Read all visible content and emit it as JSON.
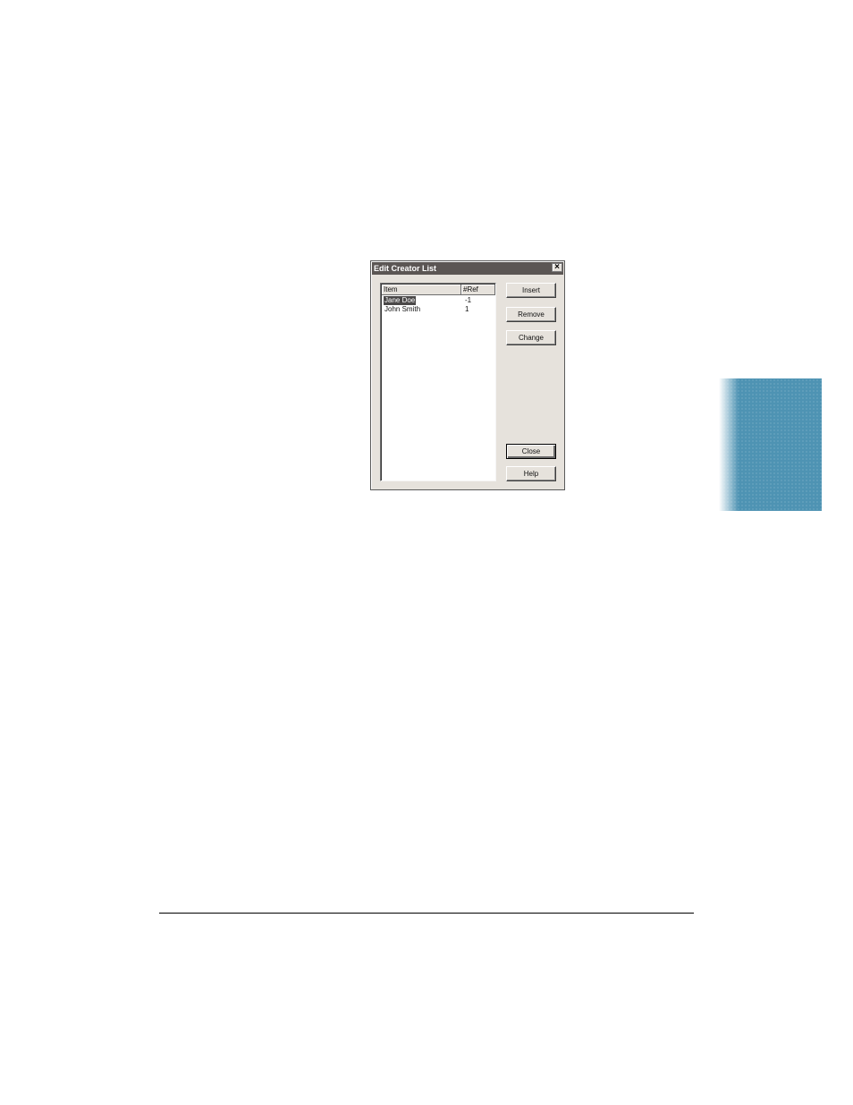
{
  "dialog": {
    "title": "Edit Creator List",
    "close_glyph": "×",
    "list": {
      "columns": [
        "Item",
        "#Ref"
      ],
      "rows": [
        {
          "item": "Jane Doe",
          "ref": "-1",
          "selected": true
        },
        {
          "item": "John Smith",
          "ref": "1",
          "selected": false
        }
      ]
    },
    "buttons": {
      "insert": "Insert",
      "remove": "Remove",
      "change": "Change",
      "close": "Close",
      "help": "Help"
    }
  },
  "colors": {
    "titlebar": "#5b5654",
    "dialog_face": "#e6e2dc",
    "selection": "#4a4848",
    "side_tab": "#4e93b3"
  }
}
